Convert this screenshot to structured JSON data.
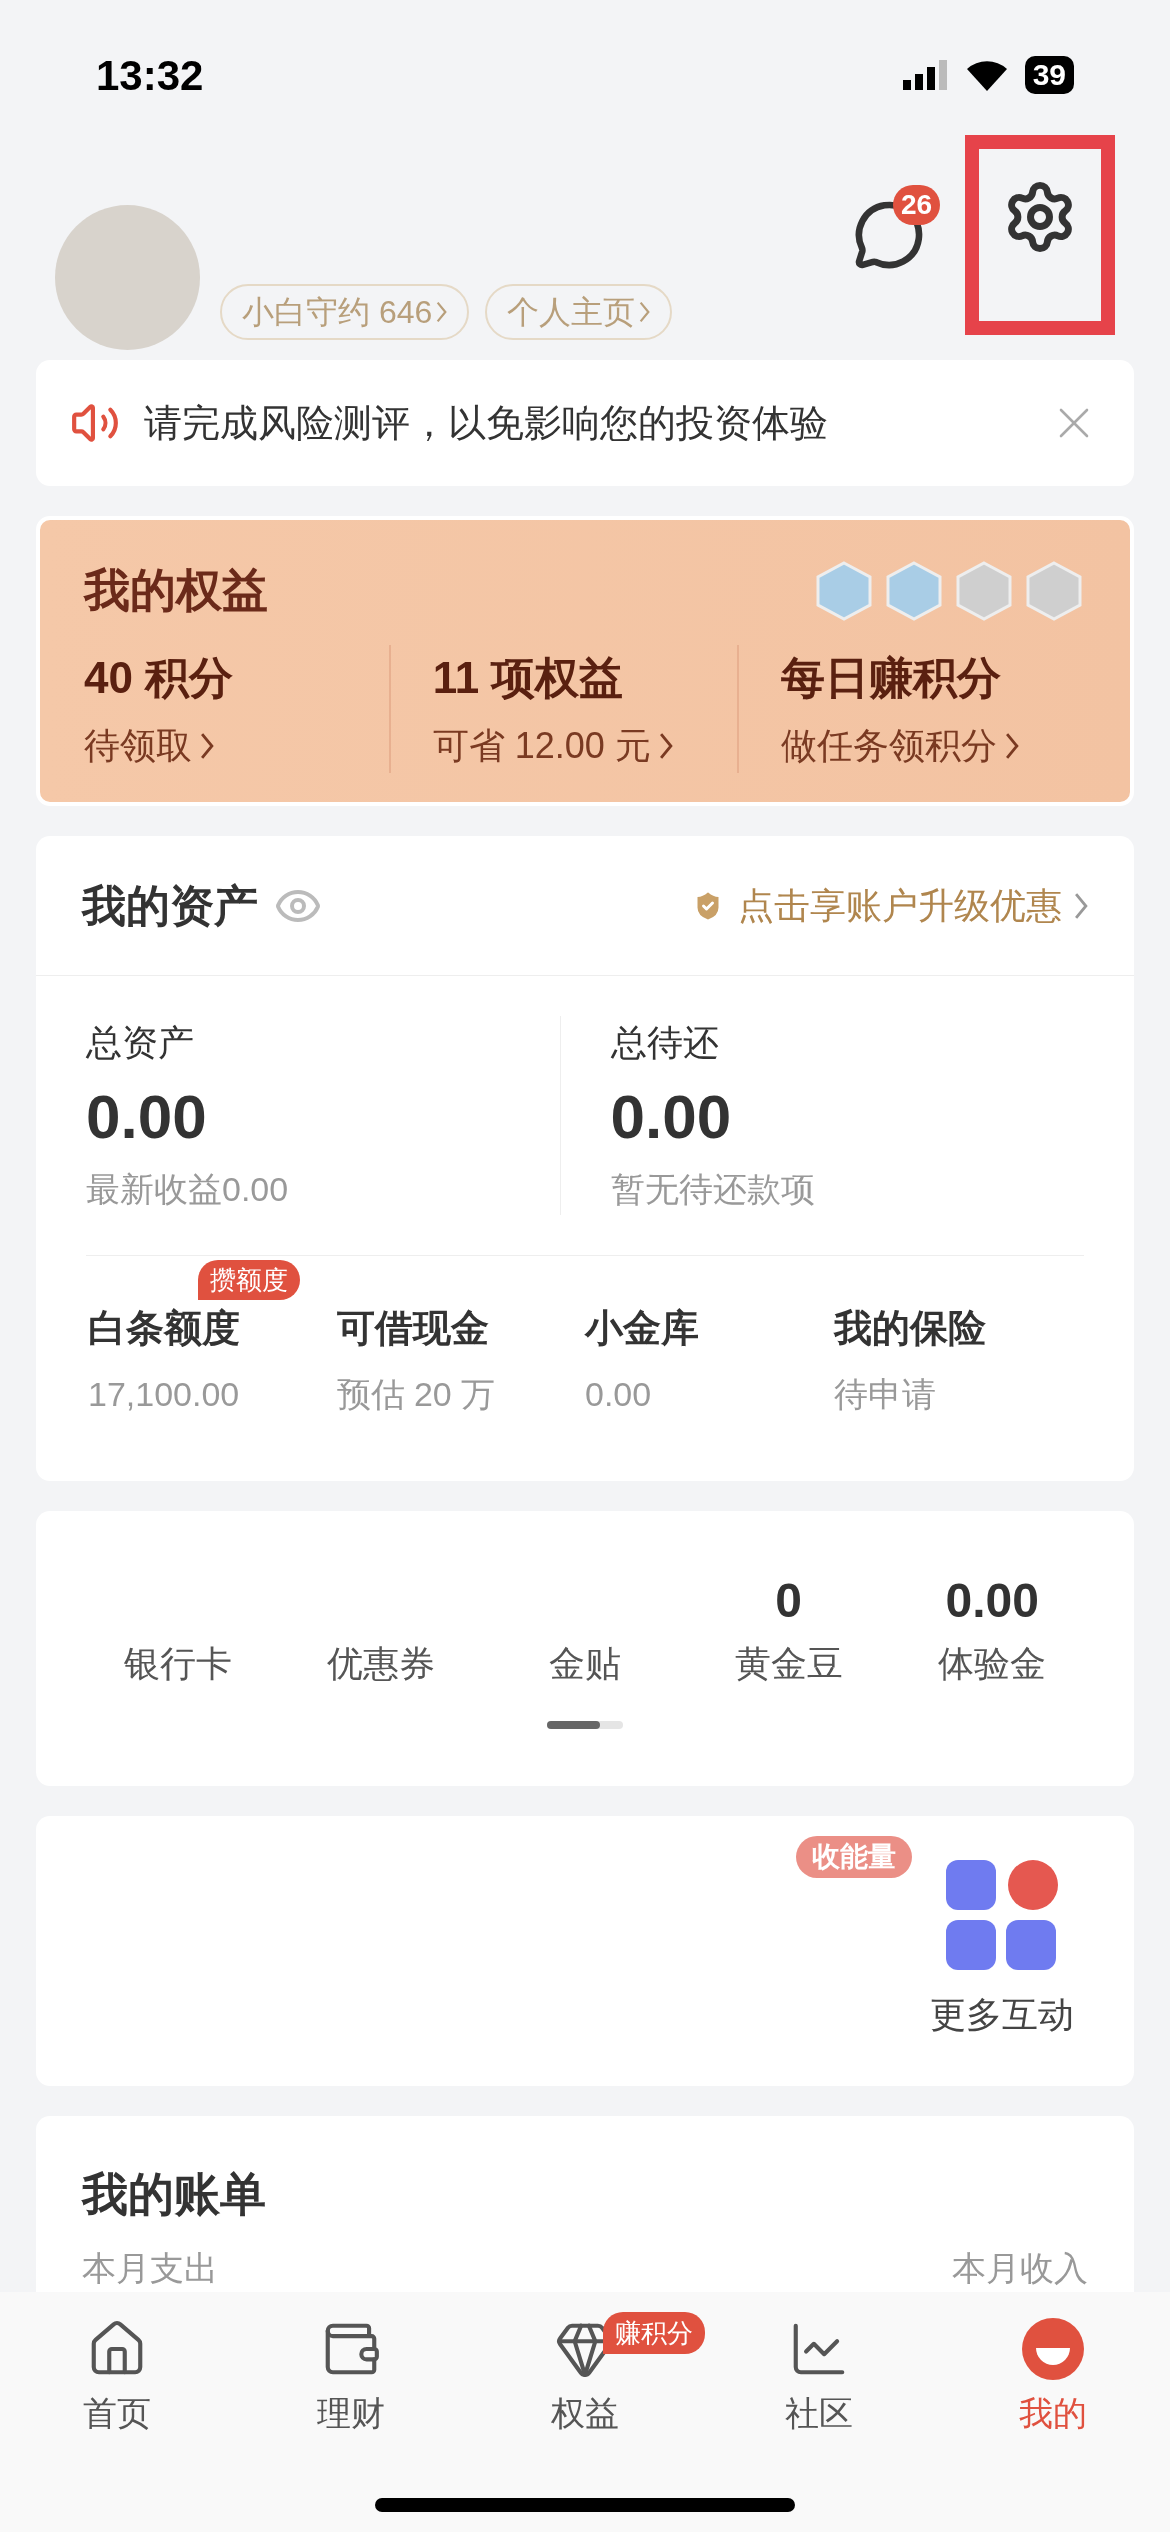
{
  "status_bar": {
    "time": "13:32",
    "battery": "39"
  },
  "header": {
    "chips": [
      "小白守约 646",
      "个人主页"
    ],
    "message_badge": "26",
    "settings_highlighted": true
  },
  "notice": {
    "text": "请完成风险测评，以免影响您的投资体验"
  },
  "benefits": {
    "title": "我的权益",
    "items": [
      {
        "value": "40 积分",
        "sub": "待领取"
      },
      {
        "value": "11 项权益",
        "sub": "可省 12.00 元"
      },
      {
        "value": "每日赚积分",
        "sub": "做任务领积分"
      }
    ]
  },
  "assets": {
    "title": "我的资产",
    "upgrade": "点击享账户升级优惠",
    "summary": [
      {
        "label": "总资产",
        "value": "0.00",
        "note": "最新收益0.00"
      },
      {
        "label": "总待还",
        "value": "0.00",
        "note": "暂无待还款项"
      }
    ],
    "products": [
      {
        "label": "白条额度",
        "value": "17,100.00",
        "badge": "攒额度"
      },
      {
        "label": "可借现金",
        "value": "预估 20 万"
      },
      {
        "label": "小金库",
        "value": "0.00"
      },
      {
        "label": "我的保险",
        "value": "待申请"
      }
    ]
  },
  "wallet": {
    "items": [
      {
        "label": "银行卡"
      },
      {
        "label": "优惠券"
      },
      {
        "label": "金贴"
      },
      {
        "label": "黄金豆",
        "value": "0"
      },
      {
        "label": "体验金",
        "value": "0.00"
      }
    ]
  },
  "interactions": {
    "items": [
      {
        "label": "收能量",
        "kind": "badge"
      },
      {
        "label": "更多互动",
        "kind": "app"
      }
    ]
  },
  "bill": {
    "title": "我的账单",
    "left": "本月支出",
    "right": "本月收入"
  },
  "tab_bar": [
    {
      "label": "首页",
      "selected": false
    },
    {
      "label": "理财",
      "selected": false
    },
    {
      "label": "权益",
      "selected": false,
      "badge": "赚积分"
    },
    {
      "label": "社区",
      "selected": false
    },
    {
      "label": "我的",
      "selected": true
    }
  ]
}
